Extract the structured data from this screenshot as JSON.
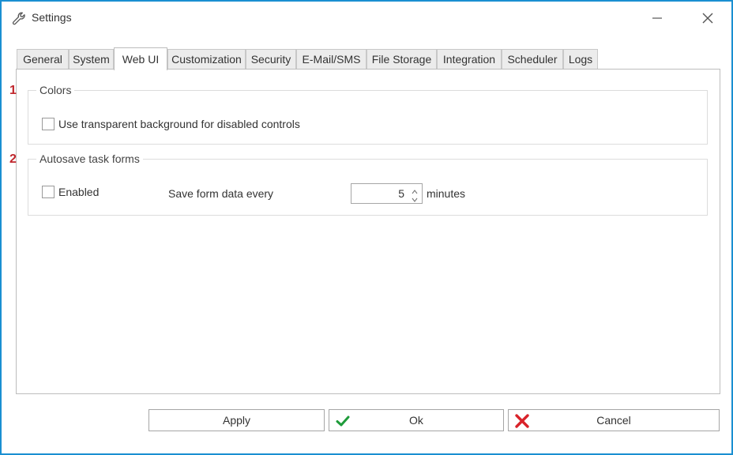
{
  "window": {
    "title": "Settings"
  },
  "tabs": [
    {
      "label": "General"
    },
    {
      "label": "System"
    },
    {
      "label": "Web UI"
    },
    {
      "label": "Customization"
    },
    {
      "label": "Security"
    },
    {
      "label": "E-Mail/SMS"
    },
    {
      "label": "File Storage"
    },
    {
      "label": "Integration"
    },
    {
      "label": "Scheduler"
    },
    {
      "label": "Logs"
    }
  ],
  "active_tab": "Web UI",
  "markers": [
    "1",
    "2"
  ],
  "colors_group": {
    "title": "Colors",
    "transparent_bg_label": "Use transparent background for disabled controls",
    "transparent_bg_checked": false
  },
  "autosave_group": {
    "title": "Autosave task forms",
    "enabled_label": "Enabled",
    "enabled_checked": false,
    "interval_label": "Save form data every",
    "interval_value": "5",
    "interval_unit": "minutes"
  },
  "buttons": {
    "apply": "Apply",
    "ok": "Ok",
    "cancel": "Cancel"
  },
  "icons": {
    "title": "wrench-icon",
    "ok": "checkmark-icon",
    "cancel": "red-x-icon"
  },
  "theme": {
    "window_border": "#1a8fd1",
    "marker_color": "#c0262c",
    "ok_icon_color": "#1e9b3a",
    "cancel_icon_color": "#d9232a"
  }
}
